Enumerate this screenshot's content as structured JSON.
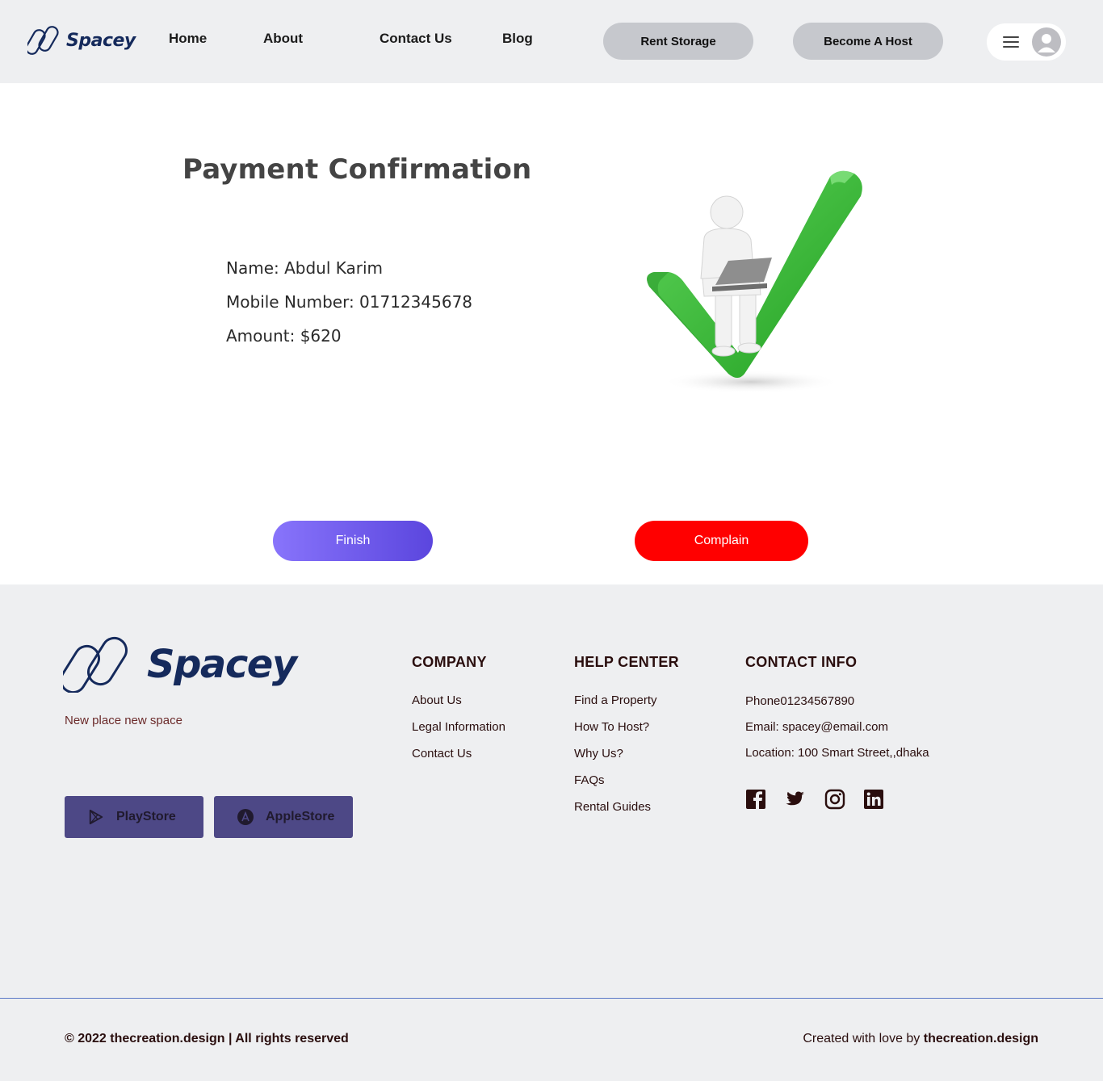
{
  "header": {
    "brand": "Spacey",
    "nav": [
      "Home",
      "About",
      "Contact Us",
      "Blog"
    ],
    "rent_storage": "Rent Storage",
    "become_host": "Become A Host"
  },
  "main": {
    "title": "Payment Confirmation",
    "name_line": "Name: Abdul Karim",
    "mobile_line": "Mobile Number: 01712345678",
    "amount_line": "Amount: $620",
    "finish_label": "Finish",
    "complain_label": "Complain"
  },
  "footer": {
    "brand": "Spacey",
    "tagline": "New place new  space",
    "playstore": "PlayStore",
    "applestore": "AppleStore",
    "company": {
      "heading": "COMPANY",
      "links": [
        "About Us",
        "Legal Information",
        "Contact Us"
      ]
    },
    "help": {
      "heading": "HELP CENTER",
      "links": [
        "Find a Property",
        "How To Host?",
        "Why Us?",
        "FAQs",
        "Rental Guides"
      ]
    },
    "contact": {
      "heading": "CONTACT INFO",
      "phone": "Phone01234567890",
      "email": "Email: spacey@email.com",
      "location": "Location: 100 Smart Street,,dhaka"
    },
    "social_icons": [
      "facebook-icon",
      "twitter-icon",
      "instagram-icon",
      "linkedin-icon"
    ],
    "copyright": "© 2022 thecreation.design | All rights reserved",
    "credit_prefix": "Created with love by ",
    "credit_name": "thecreation.design"
  },
  "colors": {
    "brand_navy": "#152a5c",
    "finish_gradient_start": "#8874fb",
    "finish_gradient_end": "#5b46de",
    "complain_red": "#ff0000",
    "store_button": "#4d4886",
    "header_bg": "#eeeff1"
  }
}
